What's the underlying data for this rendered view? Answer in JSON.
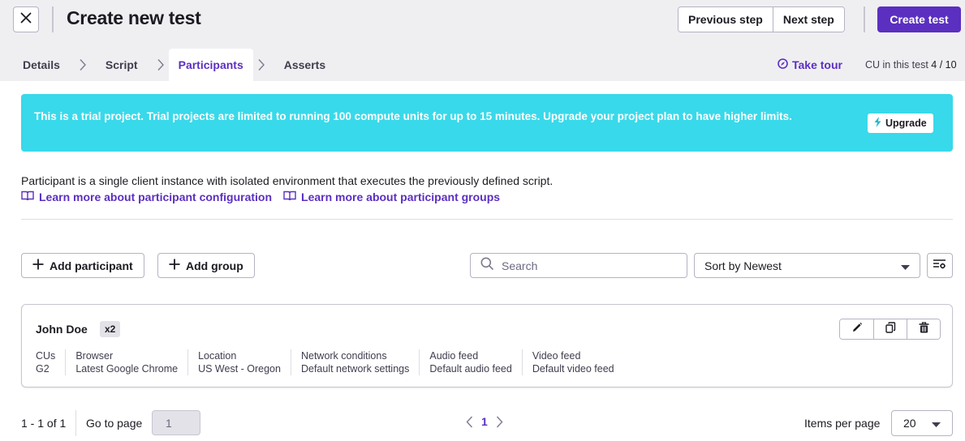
{
  "header": {
    "title": "Create new test",
    "close_icon": "close-icon",
    "previous_step_label": "Previous step",
    "next_step_label": "Next step",
    "create_label": "Create test",
    "accent_color": "#5b2fc0"
  },
  "tabs": [
    {
      "label": "Details",
      "active": false
    },
    {
      "label": "Script",
      "active": false
    },
    {
      "label": "Participants",
      "active": true
    },
    {
      "label": "Asserts",
      "active": false
    }
  ],
  "tour": {
    "label": "Take tour",
    "icon": "compass-icon"
  },
  "cu_info": {
    "label": "CU in this test",
    "value": "4 / 10"
  },
  "banner": {
    "text": "This is a trial project. Trial projects are limited to running 100 compute units for up to 15 minutes. Upgrade your project plan to have higher limits.",
    "upgrade_label": "Upgrade",
    "upgrade_icon": "lightning-icon",
    "color": "#38d9ea"
  },
  "description": {
    "text": "Participant is a single client instance with isolated environment that executes the previously defined script.",
    "links": [
      {
        "label": "Learn more about participant configuration",
        "icon": "book-icon"
      },
      {
        "label": "Learn more about participant groups",
        "icon": "book-icon"
      }
    ]
  },
  "toolbar": {
    "add_participant_label": "Add participant",
    "add_group_label": "Add group",
    "search_placeholder": "Search",
    "search_value": "",
    "sort_label": "Sort by Newest",
    "settings_icon": "list-settings-icon"
  },
  "participants": [
    {
      "name": "John Doe",
      "multiplier": "x2",
      "properties": [
        {
          "label": "CUs",
          "value": "G2"
        },
        {
          "label": "Browser",
          "value": "Latest Google Chrome"
        },
        {
          "label": "Location",
          "value": "US West - Oregon"
        },
        {
          "label": "Network conditions",
          "value": "Default network settings"
        },
        {
          "label": "Audio feed",
          "value": "Default audio feed"
        },
        {
          "label": "Video feed",
          "value": "Default video feed"
        }
      ],
      "actions": [
        "edit-icon",
        "duplicate-icon",
        "delete-icon"
      ]
    }
  ],
  "pagination": {
    "range": "1 - 1 of 1",
    "goto_label": "Go to page",
    "goto_value": "1",
    "current_page": "1",
    "items_per_page_label": "Items per page",
    "items_per_page": "20"
  }
}
